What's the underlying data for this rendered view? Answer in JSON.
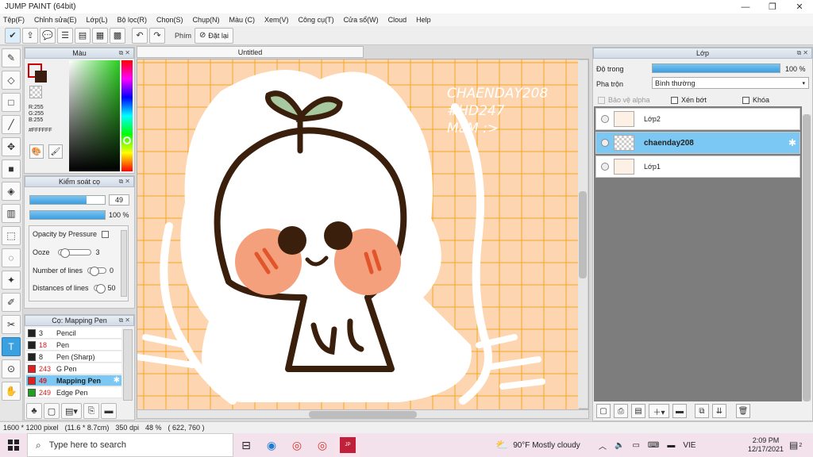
{
  "window": {
    "title": "JUMP PAINT (64bit)",
    "minimize": "—",
    "restore": "❐",
    "close": "✕"
  },
  "menu": [
    "Tệp(F)",
    "Chỉnh sửa(E)",
    "Lớp(L)",
    "Bộ lọc(R)",
    "Chọn(S)",
    "Chụp(N)",
    "Màu (C)",
    "Xem(V)",
    "Công cụ(T)",
    "Cửa sổ(W)",
    "Cloud",
    "Help"
  ],
  "toolbar": {
    "shortcut_label": "Phím",
    "reset_label": "Đặt lại"
  },
  "color_panel": {
    "title": "Màu",
    "r": "R:255",
    "g": "G:255",
    "b": "B:255",
    "hex": "#FFFFFF",
    "fg_color": "#ffffff",
    "bg_color": "#3a1f10"
  },
  "brush_panel": {
    "title": "Kiểm soát cọ",
    "size_value": "49",
    "size_fraction": 0.75,
    "opacity_value": "100 %",
    "opacity_fraction": 1.0,
    "options": [
      {
        "label": "Opacity by Pressure",
        "value": ""
      },
      {
        "label": "Ooze",
        "value": "3"
      },
      {
        "label": "Number of lines",
        "value": "0"
      },
      {
        "label": "Distances of lines",
        "value": "50"
      }
    ]
  },
  "pen_panel": {
    "title": "Cọ: Mapping Pen",
    "pens": [
      {
        "size": "3",
        "name": "Pencil",
        "color": "#222222",
        "red": false
      },
      {
        "size": "18",
        "name": "Pen",
        "color": "#222222",
        "red": true
      },
      {
        "size": "8",
        "name": "Pen (Sharp)",
        "color": "#222222",
        "red": false
      },
      {
        "size": "243",
        "name": "G Pen",
        "color": "#e02020",
        "red": true
      },
      {
        "size": "49",
        "name": "Mapping Pen",
        "color": "#e02020",
        "red": true,
        "selected": true
      },
      {
        "size": "249",
        "name": "Edge Pen",
        "color": "#20a020",
        "red": true
      }
    ]
  },
  "document": {
    "tab": "Untitled",
    "text_line1": "CHAENDAY208",
    "text_line2": "#HD247",
    "text_line3": "MàM :>",
    "bg_color": "#fdd5b0",
    "grid_color": "#f5a623",
    "cheek_color": "#f4a07c",
    "leaf_color": "#a8c8a0",
    "line_color": "#3a200c"
  },
  "layer_panel": {
    "title": "Lớp",
    "opacity_label": "Độ trong",
    "opacity_value": "100 %",
    "opacity_fraction": 1.0,
    "blend_label": "Pha trộn",
    "blend_value": "Bình thường",
    "protect_alpha": "Bảo vệ alpha",
    "clip": "Xén bớt",
    "lock": "Khóa",
    "layers": [
      {
        "name": "Lớp2",
        "selected": false
      },
      {
        "name": "chaenday208",
        "selected": true
      },
      {
        "name": "Lớp1",
        "selected": false
      }
    ]
  },
  "status": {
    "size": "1600 * 1200 pixel",
    "physical": "(11.6 * 8.7cm)",
    "dpi": "350 dpi",
    "zoom": "48 %",
    "coords": "( 622, 760 )"
  },
  "taskbar": {
    "search_placeholder": "Type here to search",
    "weather": "90°F  Mostly cloudy",
    "lang": "VIE",
    "time": "2:09 PM",
    "date": "12/17/2021",
    "notif": "2"
  }
}
